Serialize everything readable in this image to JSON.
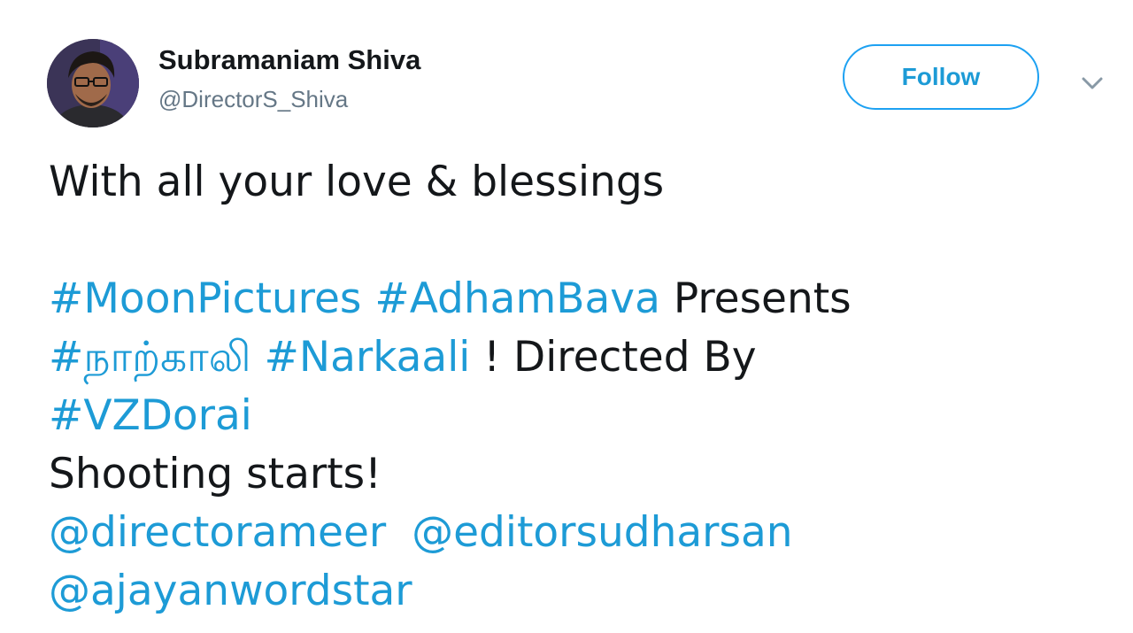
{
  "tweet": {
    "author_name": "Subramaniam Shiva",
    "author_handle": "@DirectorS_Shiva",
    "follow_label": "Follow",
    "line1": "With all your love & blessings",
    "hashtag_moonpictures": "#MoonPictures",
    "hashtag_adhambava": "#AdhamBava",
    "presents": "Presents",
    "hashtag_tamil": "#நாற்காலி",
    "hashtag_narkaali": "#Narkaali",
    "directed_by": "! Directed By",
    "hashtag_vzdorai": "#VZDorai",
    "shooting": "Shooting starts!",
    "mention_directorameer": "@directorameer",
    "mention_editorsudharsan": "@editorsudharsan",
    "mention_ajayanwordstar": "@ajayanwordstar"
  },
  "colors": {
    "link": "#1d9bd6",
    "text": "#14171a",
    "handle": "#657786",
    "follow_border": "#1da1f2"
  },
  "icons": {
    "menu_caret": "chevron-down-icon"
  }
}
